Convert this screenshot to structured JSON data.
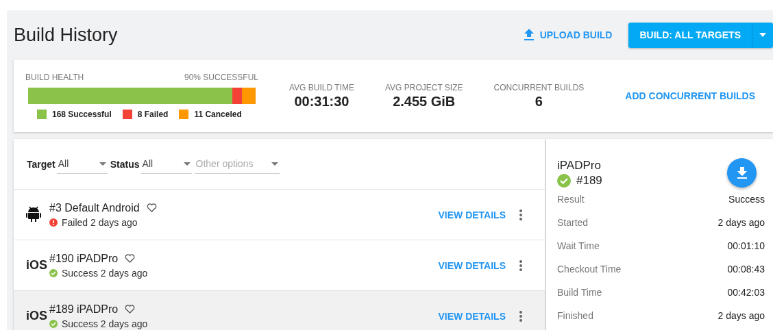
{
  "header": {
    "title": "Build History",
    "upload_label": "UPLOAD BUILD",
    "build_label": "BUILD: ALL TARGETS"
  },
  "health": {
    "label": "BUILD HEALTH",
    "summary": "90% SUCCESSFUL",
    "segments": [
      {
        "label": "168 Successful",
        "color": "#8bc34a"
      },
      {
        "label": "8 Failed",
        "color": "#f44336"
      },
      {
        "label": "11 Canceled",
        "color": "#ff9800"
      }
    ]
  },
  "stats": [
    {
      "label": "AVG BUILD TIME",
      "value": "00:31:30"
    },
    {
      "label": "AVG PROJECT SIZE",
      "value": "2.455 GiB"
    },
    {
      "label": "CONCURRENT BUILDS",
      "value": "6"
    }
  ],
  "add_link": "ADD CONCURRENT BUILDS",
  "filters": [
    {
      "label": "Target",
      "value": "All"
    },
    {
      "label": "Status",
      "value": "All"
    },
    {
      "placeholder": "Other options"
    }
  ],
  "builds": [
    {
      "kind": "android",
      "title": "#3 Default Android",
      "status": {
        "kind": "failed",
        "text": "Failed 2 days ago"
      },
      "action": "VIEW DETAILS",
      "selected": false
    },
    {
      "kind": "ios",
      "platform_label": "iOS",
      "title": "#190 iPADPro",
      "status": {
        "kind": "success",
        "text": "Success 2 days ago"
      },
      "action": "VIEW DETAILS",
      "selected": false
    },
    {
      "kind": "ios",
      "platform_label": "iOS",
      "title": "#189 iPADPro",
      "status": {
        "kind": "success",
        "text": "Success 2 days ago"
      },
      "action": "VIEW DETAILS",
      "selected": true
    }
  ],
  "detail": {
    "name": "iPADPro",
    "kind": "success",
    "number": "#189",
    "fields": [
      {
        "label": "Result",
        "value": "Success"
      },
      {
        "label": "Started",
        "value": "2 days ago"
      },
      {
        "label": "Wait Time",
        "value": "00:01:10"
      },
      {
        "label": "Checkout Time",
        "value": "00:08:43"
      },
      {
        "label": "Build Time",
        "value": "00:42:03"
      },
      {
        "label": "Finished",
        "value": "2 days ago"
      }
    ]
  }
}
